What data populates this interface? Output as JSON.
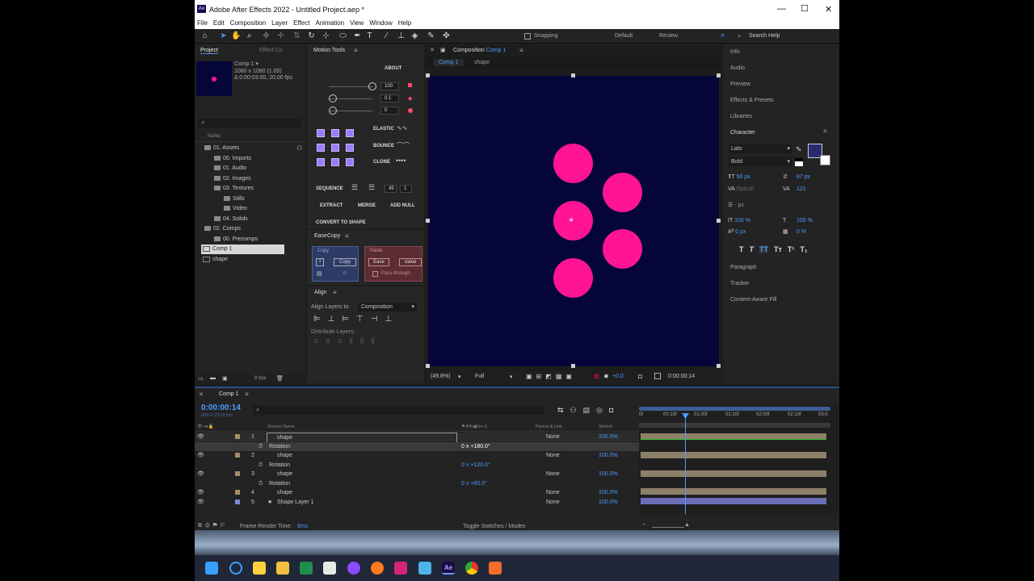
{
  "window": {
    "title": "Adobe After Effects 2022 - Untitled Project.aep *",
    "logo": "Ae"
  },
  "menu": [
    "File",
    "Edit",
    "Composition",
    "Layer",
    "Effect",
    "Animation",
    "View",
    "Window",
    "Help"
  ],
  "toolbar": {
    "snapping": "Snapping",
    "workspace_default": "Default",
    "workspace_review": "Review",
    "search_placeholder": "Search Help"
  },
  "project": {
    "tab": "Project",
    "tab2": "Effect Co",
    "comp_name": "Comp 1 ▾",
    "comp_size": "1080 x 1080 (1.00)",
    "comp_duration": "Δ 0:00:03:00, 20.00 fps",
    "col_name": "Name",
    "items": [
      "01. Assets",
      "00. Imports",
      "01. Audio",
      "02. Images",
      "03. Textures",
      "Stills",
      "Video",
      "04. Solids",
      "02. Comps",
      "00. Precomps",
      "Comp 1",
      "shape"
    ],
    "bpc": "8 bpc"
  },
  "motion_tools": {
    "title": "Motion Tools",
    "about": "ABOUT",
    "sliders": [
      "100",
      "0.1",
      "0"
    ],
    "elastic": "ELASTIC",
    "bounce": "BOUNCE",
    "clone": "CLONE",
    "sequence": "SEQUENCE",
    "seq_val1": "45",
    "seq_val2": "1",
    "extract": "EXTRACT",
    "merge": "MERGE",
    "add_null": "ADD NULL",
    "convert": "CONVERT TO SHAPE"
  },
  "easecopy": {
    "title": "EaseCopy",
    "copy_header": "Copy",
    "copy_btn": "Copy",
    "copy_q": "?",
    "copy_val": "0",
    "paste_header": "Paste",
    "ease_btn": "Ease",
    "value_btn": "Value",
    "pass": "Pass-through"
  },
  "align": {
    "title": "Align",
    "align_to_label": "Align Layers to:",
    "align_to": "Composition",
    "distribute": "Distribute Layers:"
  },
  "composition": {
    "tab_label": "Composition",
    "tab_comp": "Comp 1",
    "breadcrumb1": "Comp 1",
    "breadcrumb2": "shape",
    "zoom": "(49.8%)",
    "resolution": "Full",
    "exposure": "+0.0",
    "timecode": "0:00:00:14",
    "bg_color": "#05053a",
    "circle_color": "#ff1493"
  },
  "right_panels": {
    "items": [
      "Info",
      "Audio",
      "Preview",
      "Effects & Presets",
      "Libraries"
    ],
    "character": "Character",
    "font": "Lato",
    "style": "Bold",
    "size": "56 px",
    "leading": "87 px",
    "kerning": "Optical",
    "tracking": "121",
    "stroke": "- px",
    "vscale": "100 %",
    "hscale": "100 %",
    "baseline": "0 px",
    "tsume": "0 %",
    "styles": [
      "T",
      "T",
      "TT",
      "Tт",
      "T¹",
      "T₁"
    ],
    "lower": [
      "Paragraph",
      "Tracker",
      "Content-Aware Fill"
    ],
    "fill_color": "#2a2a6e"
  },
  "timeline": {
    "tab": "Comp 1",
    "timecode": "0:00:00:14",
    "frames": "00014 (20.00 fps)",
    "col_source": "Source Name",
    "col_parent": "Parent & Link",
    "col_stretch": "Stretch",
    "ruler": [
      "0f",
      "00:10f",
      "01:00f",
      "01:10f",
      "02:00f",
      "02:10f",
      "03:0"
    ],
    "layers": [
      {
        "num": "1",
        "name": "shape",
        "parent": "None",
        "stretch": "100.0%"
      },
      {
        "prop": "Rotation",
        "value": "0 x +180.0°"
      },
      {
        "num": "2",
        "name": "shape",
        "parent": "None",
        "stretch": "100.0%"
      },
      {
        "prop": "Rotation",
        "value": "0 x +120.0°"
      },
      {
        "num": "3",
        "name": "shape",
        "parent": "None",
        "stretch": "100.0%"
      },
      {
        "prop": "Rotation",
        "value": "0 x +60.0°"
      },
      {
        "num": "4",
        "name": "shape",
        "parent": "None",
        "stretch": "100.0%"
      },
      {
        "num": "5",
        "name": "Shape Layer 1",
        "parent": "None",
        "stretch": "100.0%"
      }
    ],
    "render_label": "Frame Render Time:",
    "render_value": "8ms",
    "toggle": "Toggle Switches / Modes"
  },
  "taskbar": {
    "icons": [
      "windows-start-icon",
      "cortana-icon",
      "sticky-notes-icon",
      "file-explorer-icon",
      "excel-icon",
      "snipping-icon",
      "messenger-icon",
      "firefox-icon",
      "instagram-icon",
      "notepad-icon",
      "after-effects-icon",
      "chrome-icon",
      "media-icon"
    ],
    "ae": "Ae"
  }
}
